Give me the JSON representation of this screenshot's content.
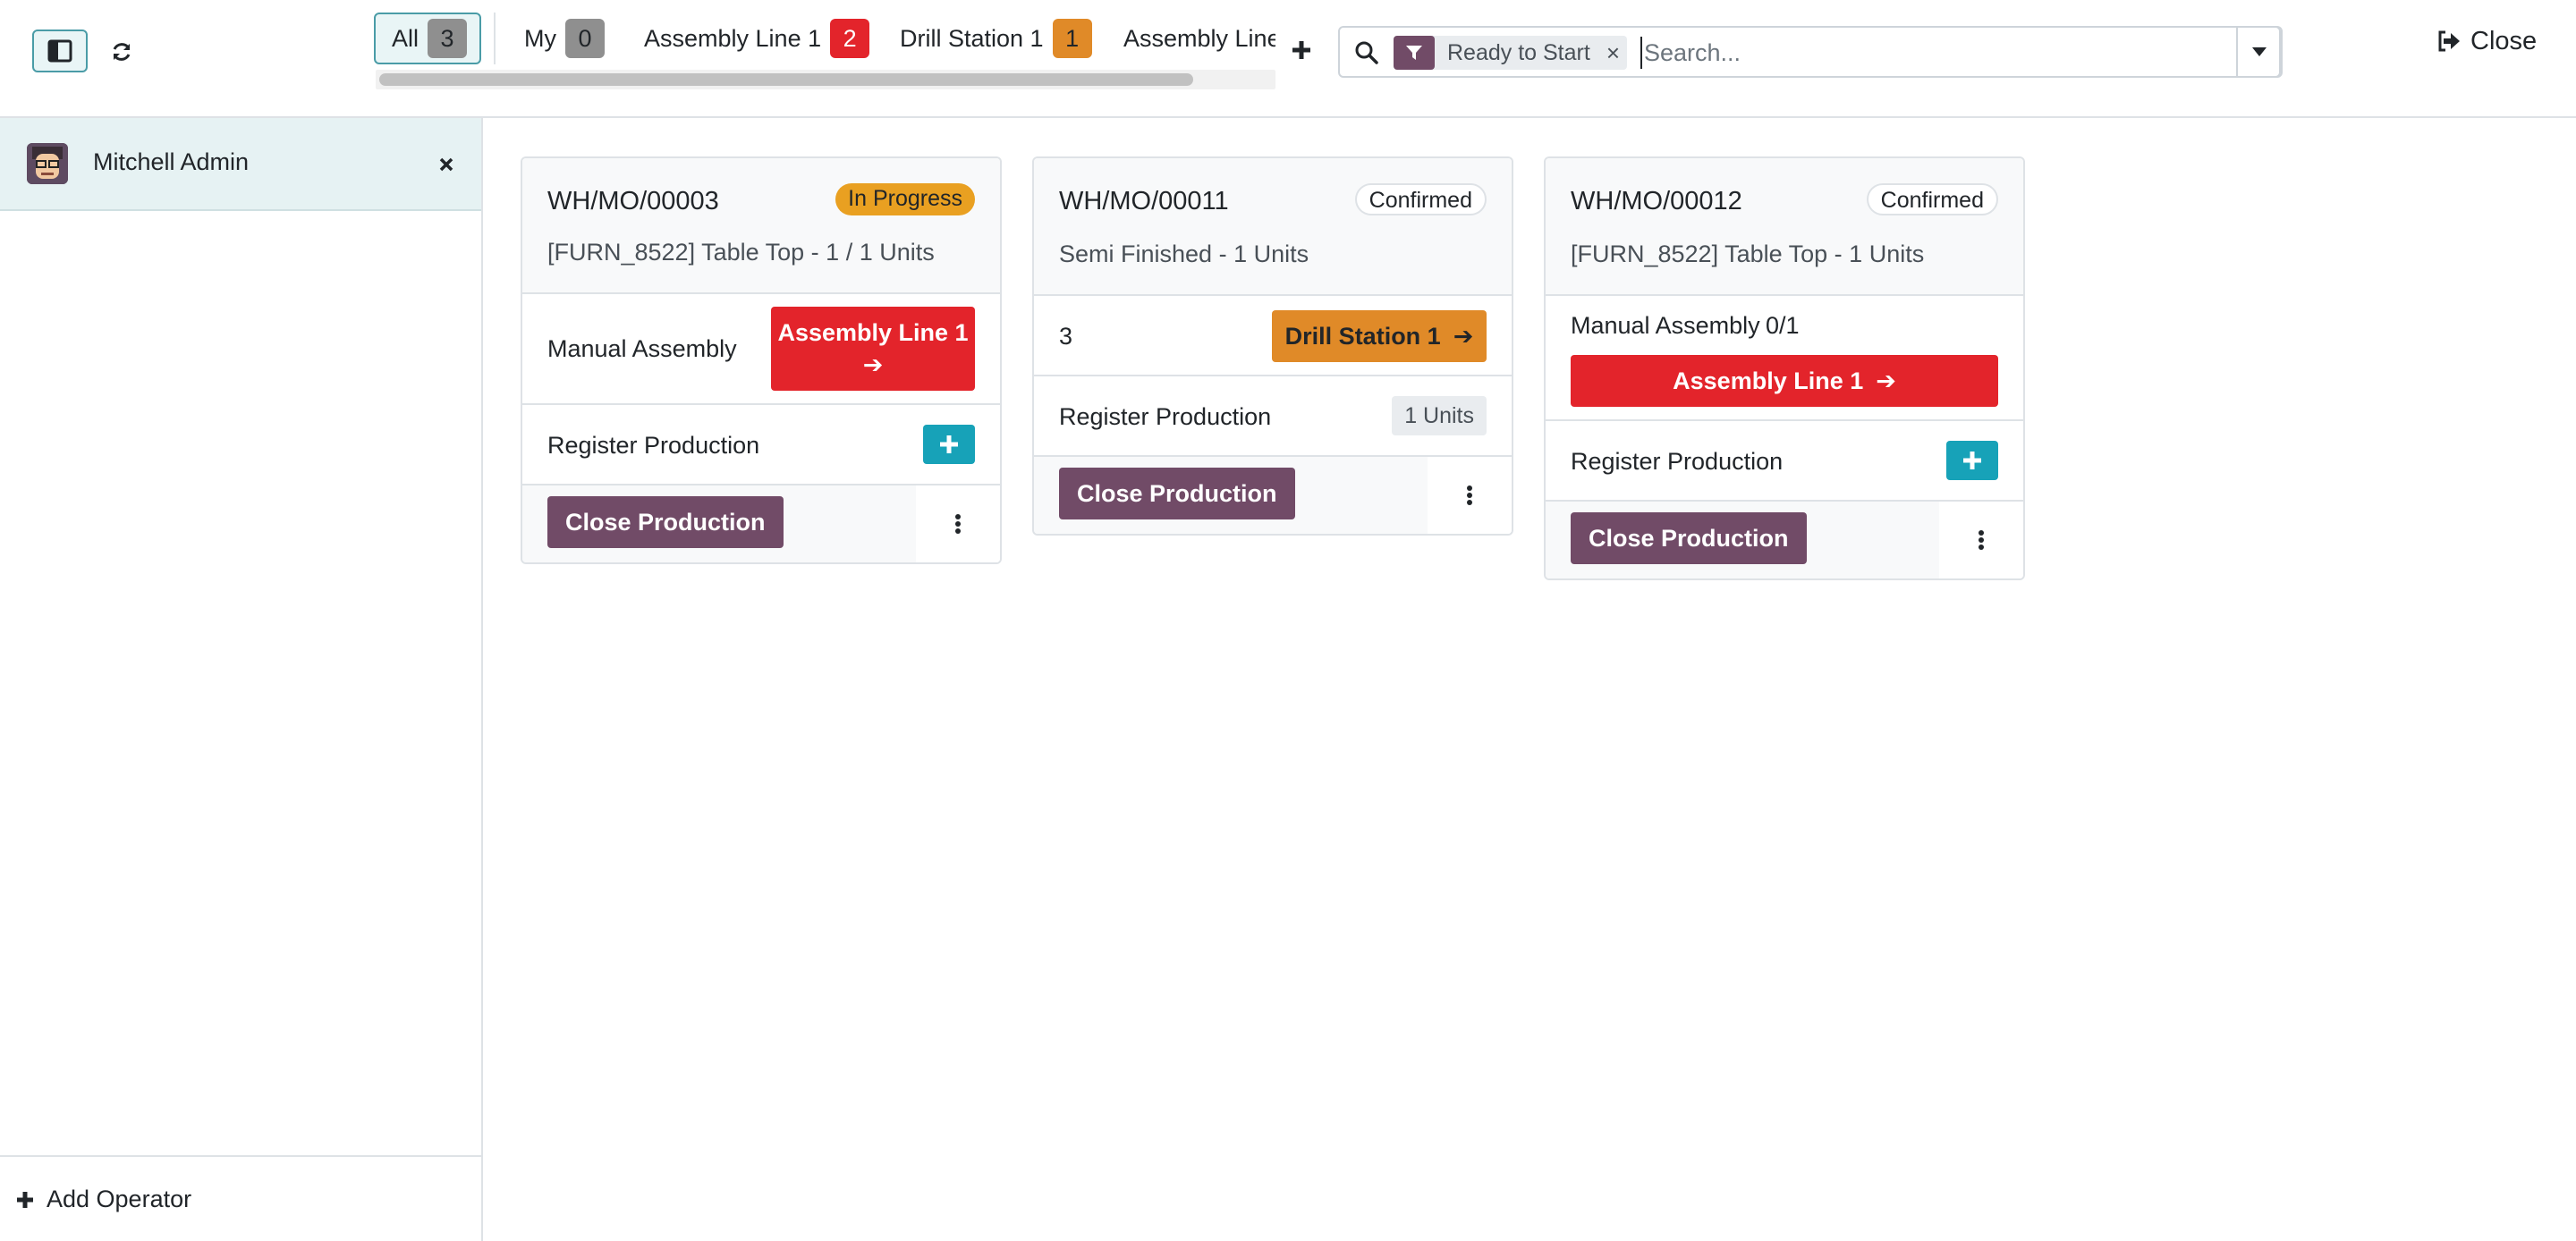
{
  "topbar": {
    "tabs": [
      {
        "label": "All",
        "count": "3"
      },
      {
        "label": "My",
        "count": "0"
      },
      {
        "label": "Assembly Line 1",
        "count": "2"
      },
      {
        "label": "Drill Station 1",
        "count": "1"
      },
      {
        "label": "Assembly Line"
      }
    ],
    "search": {
      "facet": "Ready to Start",
      "facet_remove": "×",
      "placeholder": "Search..."
    },
    "close_label": "Close"
  },
  "sidebar": {
    "operator_name": "Mitchell Admin",
    "add_operator_label": "Add Operator"
  },
  "cards": [
    {
      "title": "WH/MO/00003",
      "status": "In Progress",
      "subtitle": "[FURN_8522] Table Top - 1 / 1 Units",
      "op_label": "Manual Assembly",
      "op_workcenter_line1": "Assembly Line 1",
      "op_arrow": "➔",
      "register_label": "Register Production",
      "close_label": "Close Production"
    },
    {
      "title": "WH/MO/00011",
      "status": "Confirmed",
      "subtitle": "Semi Finished - 1 Units",
      "op_label": "3",
      "op_workcenter": "Drill Station 1",
      "op_arrow": "➔",
      "register_label": "Register Production",
      "register_qty": "1 Units",
      "close_label": "Close Production"
    },
    {
      "title": "WH/MO/00012",
      "status": "Confirmed",
      "subtitle": "[FURN_8522] Table Top - 1 Units",
      "op_label": "Manual Assembly",
      "op_progress": "0/1",
      "op_workcenter": "Assembly Line 1",
      "op_arrow": "➔",
      "register_label": "Register Production",
      "close_label": "Close Production"
    }
  ],
  "colors": {
    "primary": "#714b67",
    "teal": "#17a2b8",
    "red": "#e3242b",
    "orange": "#e08a28",
    "in_progress": "#e9a021"
  }
}
